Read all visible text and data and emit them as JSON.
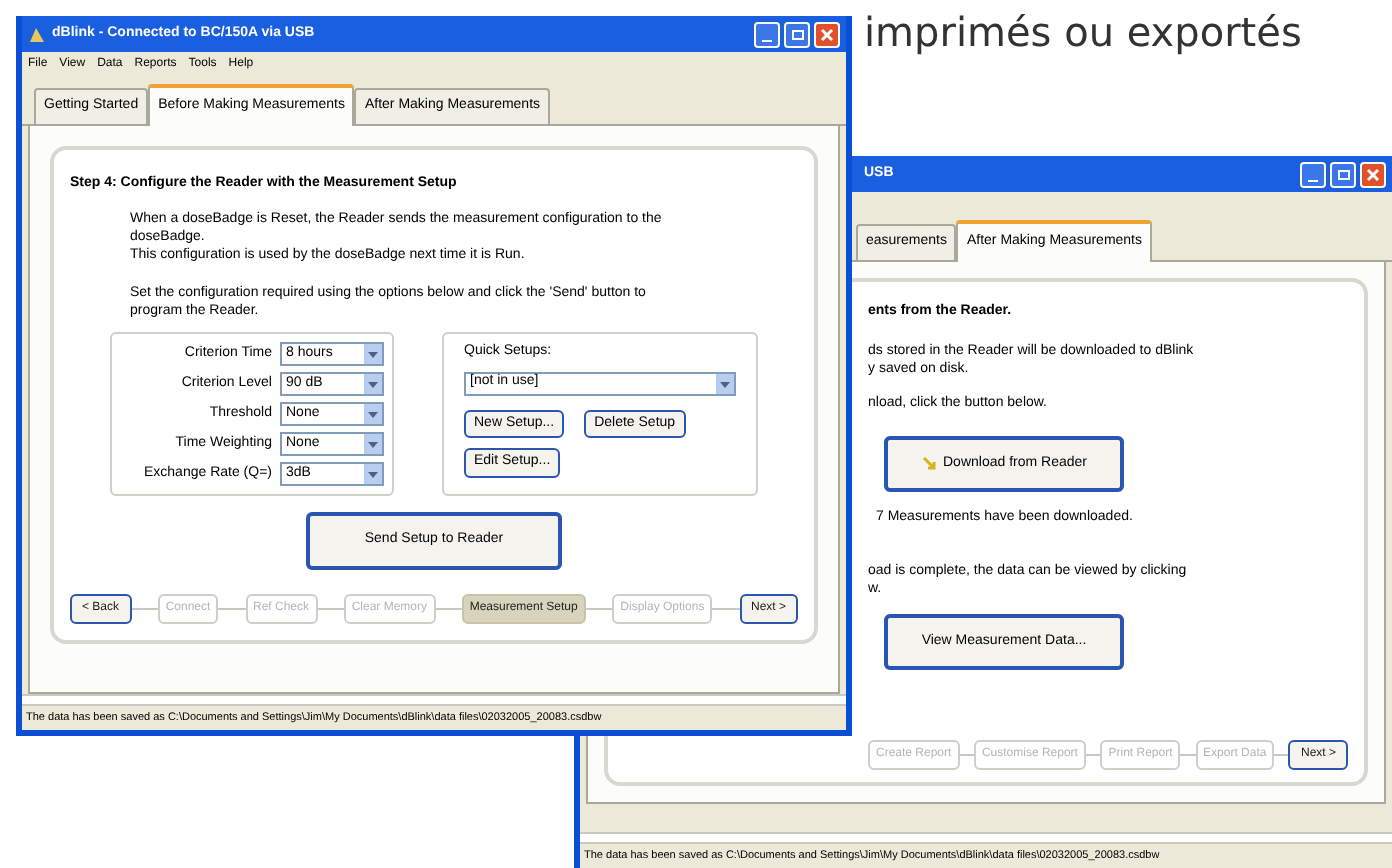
{
  "caption": "imprimés ou exportés",
  "back_window": {
    "title": "USB",
    "tabs": [
      {
        "label": "easurements",
        "selected": false
      },
      {
        "label": "After Making Measurements",
        "selected": true
      }
    ],
    "heading": "ents from the Reader.",
    "paragraph_1": [
      "ds stored in the Reader will be downloaded to dBlink",
      "y saved on disk."
    ],
    "paragraph_2": "nload, click the button below.",
    "download_button": "Download from Reader",
    "download_message": "7 Measurements have been downloaded.",
    "paragraph_3": [
      "oad is complete, the data can be viewed by clicking",
      "w."
    ],
    "view_button": "View Measurement Data...",
    "wizard": [
      {
        "label": "Create Report",
        "kind": "step",
        "selected": false,
        "disabled": true
      },
      {
        "label": "Customise Report",
        "kind": "step",
        "selected": false,
        "disabled": true
      },
      {
        "label": "Print Report",
        "kind": "step",
        "selected": false,
        "disabled": true
      },
      {
        "label": "Export Data",
        "kind": "step",
        "selected": false,
        "disabled": true
      },
      {
        "label": "Next >",
        "kind": "nav",
        "disabled": false
      }
    ],
    "status": "The data has been saved as C:\\Documents and Settings\\Jim\\My Documents\\dBlink\\data files\\02032005_20083.csdbw"
  },
  "front_window": {
    "title": "dBlink - Connected to BC/150A via USB",
    "menu": [
      "File",
      "View",
      "Data",
      "Reports",
      "Tools",
      "Help"
    ],
    "tabs": [
      {
        "label": "Getting Started",
        "selected": false
      },
      {
        "label": "Before Making Measurements",
        "selected": true
      },
      {
        "label": "After Making Measurements",
        "selected": false
      }
    ],
    "step_title": "Step 4: Configure the Reader with the Measurement Setup",
    "intro": [
      "When a doseBadge is Reset, the Reader sends the measurement configuration to the doseBadge.",
      "This configuration is used by the doseBadge next time it is Run."
    ],
    "instruction": "Set the configuration required using the options below and click the 'Send' button to program the Reader.",
    "settings": [
      {
        "label": "Criterion Time",
        "value": "8 hours"
      },
      {
        "label": "Criterion Level",
        "value": "90 dB"
      },
      {
        "label": "Threshold",
        "value": "None"
      },
      {
        "label": "Time Weighting",
        "value": "None"
      },
      {
        "label": "Exchange Rate (Q=)",
        "value": "3dB"
      }
    ],
    "quick_setups": {
      "label": "Quick Setups:",
      "value": "[not in use]",
      "buttons": [
        "New Setup...",
        "Delete Setup",
        "Edit Setup..."
      ]
    },
    "send_button": "Send Setup to Reader",
    "wizard": [
      {
        "label": "< Back",
        "kind": "nav",
        "disabled": false
      },
      {
        "label": "Connect",
        "kind": "step",
        "selected": false,
        "disabled": true
      },
      {
        "label": "Ref Check",
        "kind": "step",
        "selected": false,
        "disabled": true
      },
      {
        "label": "Clear Memory",
        "kind": "step",
        "selected": false,
        "disabled": true
      },
      {
        "label": "Measurement Setup",
        "kind": "step",
        "selected": true,
        "disabled": false
      },
      {
        "label": "Display Options",
        "kind": "step",
        "selected": false,
        "disabled": true
      },
      {
        "label": "Next >",
        "kind": "nav",
        "disabled": false
      }
    ],
    "status": "The data has been saved as C:\\Documents and Settings\\Jim\\My Documents\\dBlink\\data files\\02032005_20083.csdbw"
  }
}
